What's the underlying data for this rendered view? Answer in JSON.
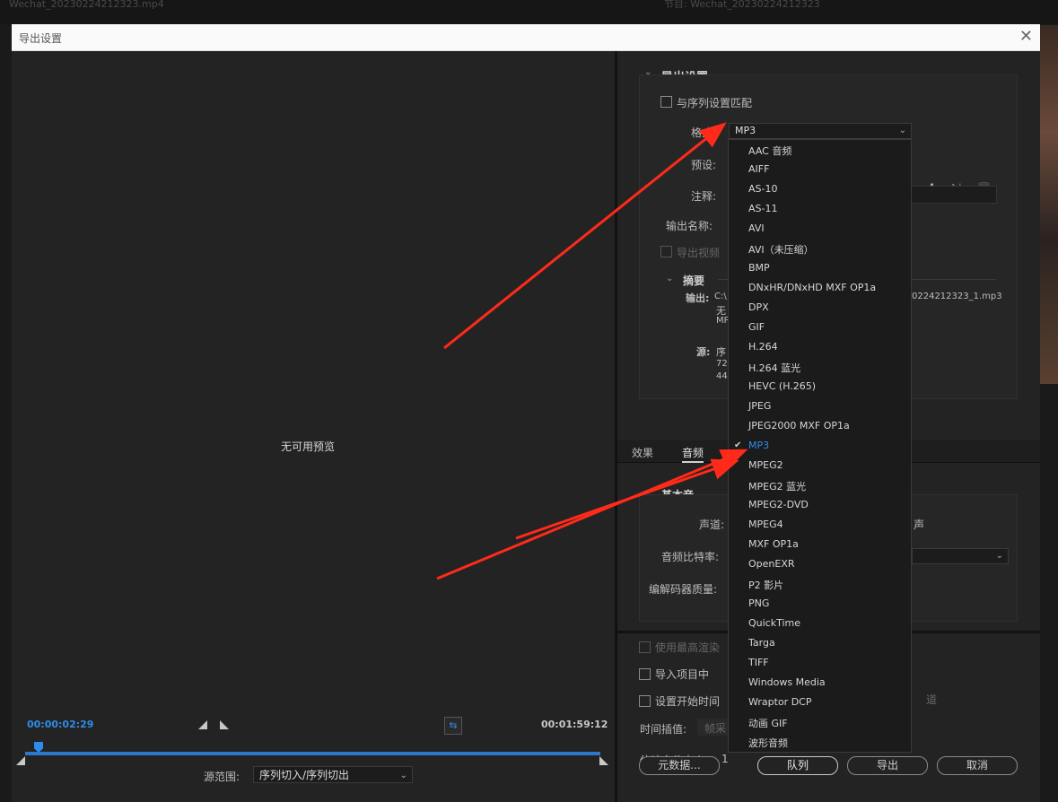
{
  "background": {
    "tab_left": "Wechat_20230224212323.mp4",
    "tab_right": "节目: Wechat_20230224212323"
  },
  "dialog": {
    "title": "导出设置"
  },
  "preview": {
    "no_preview_text": "无可用预览",
    "current_time": "00:00:02:29",
    "duration": "00:01:59:12",
    "source_range_label": "源范围:",
    "source_range_value": "序列切入/序列切出"
  },
  "export_settings": {
    "section_title": "导出设置",
    "match_sequence_label": "与序列设置匹配",
    "format_label": "格式:",
    "format_value": "MP3",
    "preset_label": "预设:",
    "comment_label": "注释:",
    "output_name_label": "输出名称:",
    "export_video_label": "导出视频",
    "summary_title": "摘要",
    "output_label": "输出:",
    "output_path_start": "C:\\",
    "output_path_end": "0224212323_1.mp3",
    "output_line2": "无",
    "output_line3": "MP",
    "source_label": "源:",
    "source_line1": "序",
    "source_line2": "720",
    "source_line3": "441"
  },
  "tabs": [
    {
      "label": "效果"
    },
    {
      "label": "音频",
      "active": true
    }
  ],
  "audio_settings": {
    "section_title": "基本音",
    "channel_label": "声道:",
    "channel_value_tail": "声",
    "bitrate_label": "音频比特率:",
    "codec_quality_label": "编解码器质量:"
  },
  "bottom_options": {
    "max_render_label": "使用最高渲染",
    "import_project_label": "导入项目中",
    "set_start_time_label": "设置开始时间",
    "channel_tail": "道",
    "time_interp_label": "时间插值:",
    "time_interp_value": "帧采",
    "est_size_label": "估计文件大小:",
    "est_size_value": "1"
  },
  "buttons": {
    "metadata": "元数据...",
    "queue": "队列",
    "export": "导出",
    "cancel": "取消"
  },
  "format_dropdown": {
    "items": [
      "AAC 音频",
      "AIFF",
      "AS-10",
      "AS-11",
      "AVI",
      "AVI（未压缩）",
      "BMP",
      "DNxHR/DNxHD MXF OP1a",
      "DPX",
      "GIF",
      "H.264",
      "H.264 蓝光",
      "HEVC (H.265)",
      "JPEG",
      "JPEG2000 MXF OP1a",
      "MP3",
      "MPEG2",
      "MPEG2 蓝光",
      "MPEG2-DVD",
      "MPEG4",
      "MXF OP1a",
      "OpenEXR",
      "P2 影片",
      "PNG",
      "QuickTime",
      "Targa",
      "TIFF",
      "Windows Media",
      "Wraptor DCP",
      "动画 GIF",
      "波形音频"
    ],
    "selected": "MP3"
  },
  "colors": {
    "accent": "#2d8ceb",
    "annotation_arrow": "#ff2a1a"
  }
}
